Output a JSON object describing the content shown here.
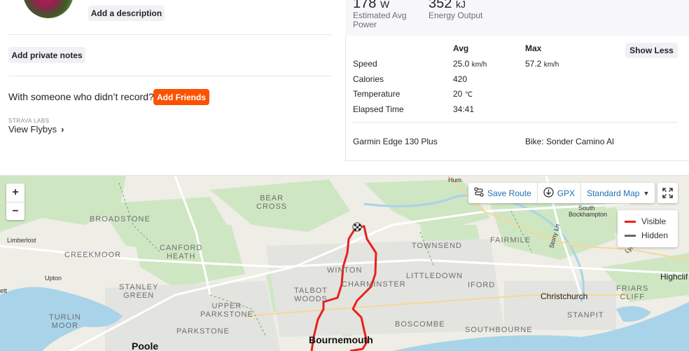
{
  "profile": {
    "add_description": "Add a description",
    "add_private_notes": "Add private notes",
    "with_someone": "With someone who didn’t record?",
    "add_friends": "Add Friends",
    "labs_label": "STRAVA LABS",
    "view_flybys": "View Flybys"
  },
  "summary": {
    "power_value": "178",
    "power_unit": "W",
    "power_label_1": "Estimated Avg",
    "power_label_2": "Power",
    "energy_value": "352",
    "energy_unit": "kJ",
    "energy_label": "Energy Output"
  },
  "stats": {
    "col_avg": "Avg",
    "col_max": "Max",
    "show_less": "Show Less",
    "rows": [
      {
        "label": "Speed",
        "avg": "25.0",
        "avg_unit": "km/h",
        "max": "57.2",
        "max_unit": "km/h"
      },
      {
        "label": "Calories",
        "avg": "420",
        "avg_unit": "",
        "max": "",
        "max_unit": ""
      },
      {
        "label": "Temperature",
        "avg": "20",
        "avg_unit": "℃",
        "max": "",
        "max_unit": ""
      },
      {
        "label": "Elapsed Time",
        "avg": "34:41",
        "avg_unit": "",
        "max": "",
        "max_unit": ""
      }
    ],
    "device": "Garmin Edge 130 Plus",
    "bike": "Bike: Sonder Camino Al"
  },
  "map": {
    "zoom_in": "+",
    "zoom_out": "−",
    "save_route": "Save Route",
    "gpx": "GPX",
    "map_type": "Standard Map",
    "legend_visible": "Visible",
    "legend_hidden": "Hidden",
    "colors": {
      "route": "#e8211d",
      "hidden": "#666666",
      "water": "#a9d3e9",
      "green": "#cde5c0",
      "accent": "#fc5200",
      "link": "#1f6fb6"
    },
    "places": {
      "hum": "Hum",
      "bear": "BEAR",
      "cross": "CROSS",
      "south": "South",
      "bockhampton": "Bockhampton",
      "broadstone": "BROADSTONE",
      "limberlost": "Limberlost",
      "creekmoor": "CREEKMOOR",
      "canford": "CANFORD",
      "heath": "HEATH",
      "townsend": "TOWNSEND",
      "fairmile": "FAIRMILE",
      "stony_ln": "Stony Ln",
      "lyn": "Lyn",
      "upton": "Upton",
      "winton": "WINTON",
      "littledown": "LITTLEDOWN",
      "highcliffe": "Highclif",
      "stanley": "STANLEY",
      "green": "GREEN",
      "charminster": "CHARMINSTER",
      "iford": "IFORD",
      "christchurch": "Christchurch",
      "friars": "FRIARS",
      "cliff": "CLIFF",
      "ett": "ett",
      "talbot": "TALBOT",
      "woods": "WOODS",
      "upper": "UPPER",
      "parkstone": "PARKSTONE",
      "turlin": "TURLIN",
      "moor": "MOOR",
      "boscombe": "BOSCOMBE",
      "stanpit": "STANPIT",
      "parkstone2": "PARKSTONE",
      "southbourne": "SOUTHBOURNE",
      "poole": "Poole",
      "bournemouth": "Bournemouth"
    }
  }
}
